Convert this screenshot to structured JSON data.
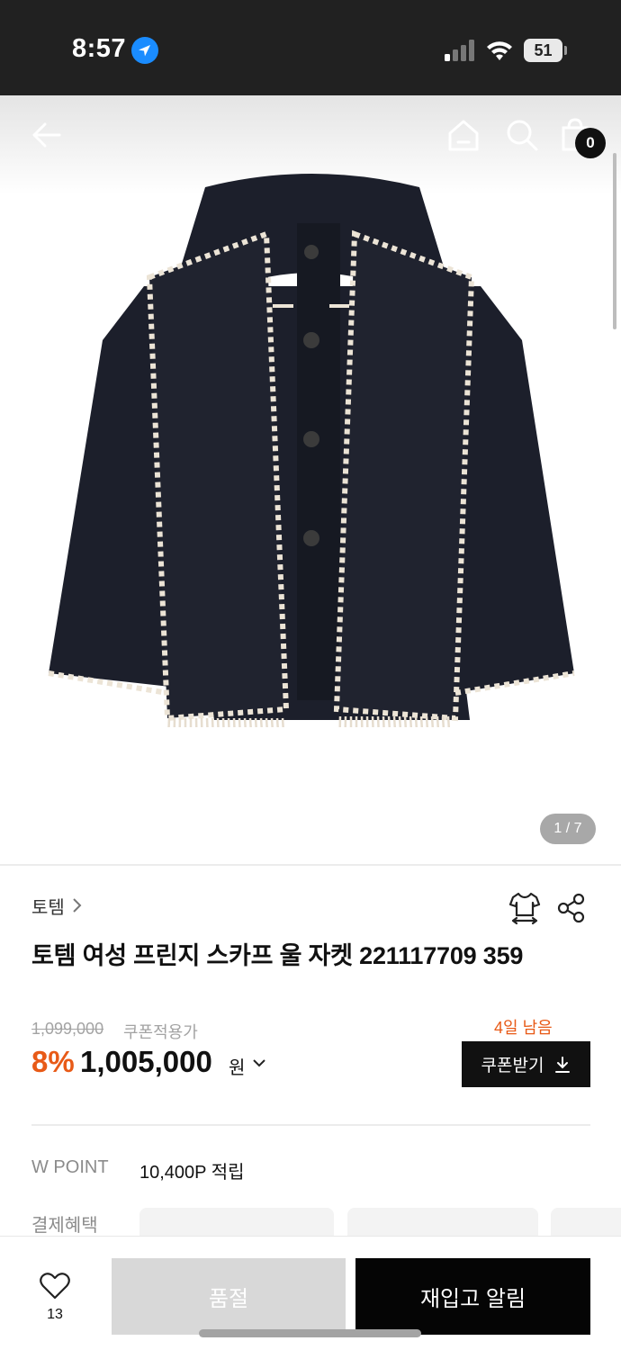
{
  "status_bar": {
    "time": "8:57",
    "battery": "51"
  },
  "header": {
    "cart_count": "0"
  },
  "gallery": {
    "counter": "1 / 7"
  },
  "product": {
    "brand": "토템",
    "title": "토템 여성 프린지 스카프 울 자켓 221117709 359"
  },
  "price": {
    "original": "1,099,000",
    "coupon_note": "쿠폰적용가",
    "days_left": "4일 남음",
    "discount": "8%",
    "sale": "1,005,000",
    "currency": "원",
    "coupon_button": "쿠폰받기"
  },
  "benefits": {
    "wpoint_label": "W POINT",
    "wpoint_value": "10,400P 적립",
    "payment_label": "결제혜택"
  },
  "bottom_bar": {
    "like_count": "13",
    "soldout_label": "품절",
    "restock_label": "재입고 알림"
  },
  "colors": {
    "accent": "#e85a17",
    "status_bar_bg": "#212121",
    "primary_button": "#050505",
    "disabled_button": "#d8d8d8",
    "jacket": "#1c1f2b",
    "trim": "#ece4d6"
  },
  "icons": {
    "status": [
      "location-arrow-icon",
      "signal-icon",
      "wifi-icon",
      "battery-icon"
    ],
    "header": [
      "back-arrow-icon",
      "home-icon",
      "search-icon",
      "cart-icon"
    ],
    "product": [
      "chevron-right-icon",
      "size-fit-icon",
      "share-icon",
      "chevron-down-icon",
      "download-icon",
      "heart-icon"
    ]
  }
}
